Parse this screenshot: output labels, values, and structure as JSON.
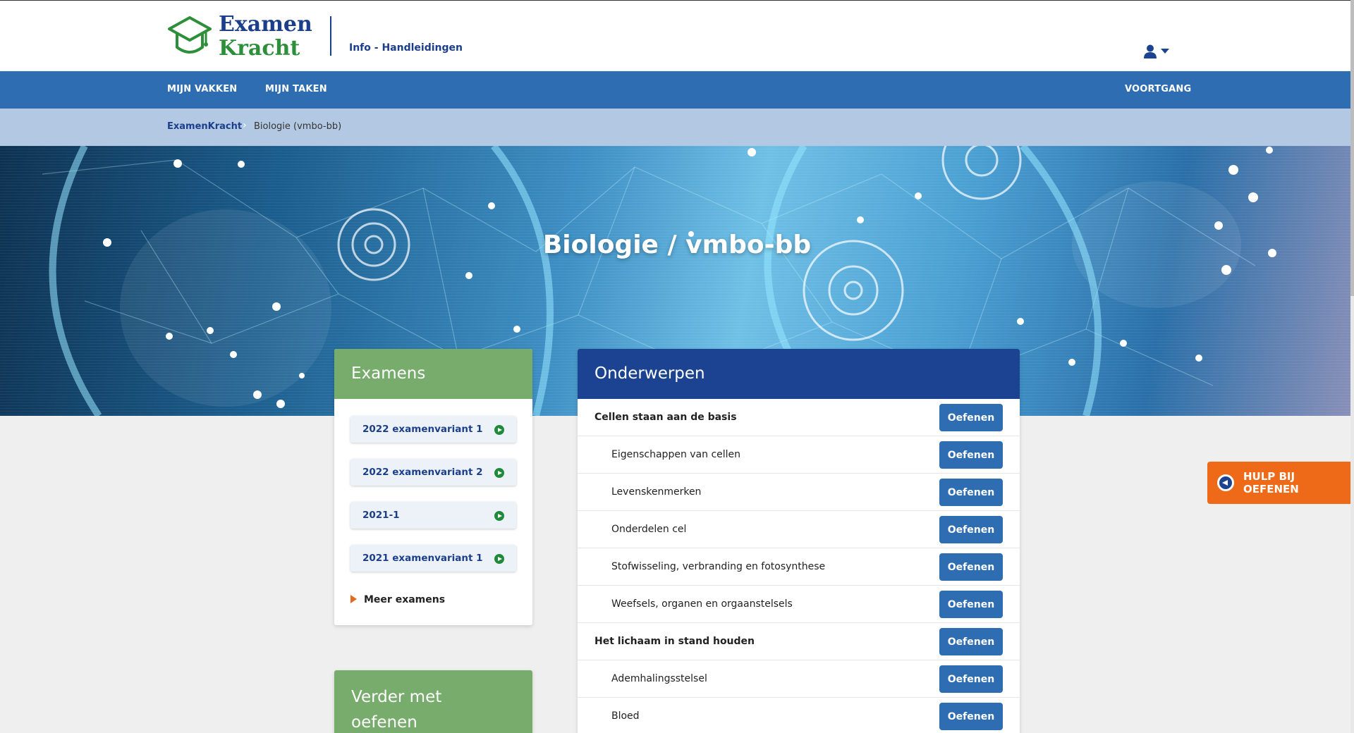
{
  "header": {
    "logo_line1": "Examen",
    "logo_line2": "Kracht",
    "info_link": "Info - Handleidingen"
  },
  "nav": {
    "mijn_vakken": "MIJN VAKKEN",
    "mijn_taken": "MIJN TAKEN",
    "voortgang": "VOORTGANG"
  },
  "breadcrumb": {
    "home": "ExamenKracht",
    "current": "Biologie (vmbo-bb)"
  },
  "hero": {
    "title": "Biologie / vmbo-bb"
  },
  "examens": {
    "title": "Examens",
    "items": [
      {
        "label": "2022 examenvariant 1"
      },
      {
        "label": "2022 examenvariant 2"
      },
      {
        "label": "2021-1"
      },
      {
        "label": "2021 examenvariant 1"
      }
    ],
    "more": "Meer examens"
  },
  "verder": {
    "title_line1": "Verder met",
    "title_line2": "oefenen"
  },
  "onderwerpen": {
    "title": "Onderwerpen",
    "button_label": "Oefenen",
    "rows": [
      {
        "label": "Cellen staan aan de basis",
        "level": "main"
      },
      {
        "label": "Eigenschappen van cellen",
        "level": "sub"
      },
      {
        "label": "Levenskenmerken",
        "level": "sub"
      },
      {
        "label": "Onderdelen cel",
        "level": "sub"
      },
      {
        "label": "Stofwisseling, verbranding en fotosynthese",
        "level": "sub"
      },
      {
        "label": "Weefsels, organen en orgaanstelsels",
        "level": "sub"
      },
      {
        "label": "Het lichaam in stand houden",
        "level": "main"
      },
      {
        "label": "Ademhalingsstelsel",
        "level": "sub"
      },
      {
        "label": "Bloed",
        "level": "sub"
      }
    ]
  },
  "help_tab": {
    "label": "HULP BIJ OEFENEN"
  },
  "colors": {
    "primary_blue": "#2f6db3",
    "dark_blue": "#1b4392",
    "green": "#78ac6c",
    "orange": "#ef6a18"
  },
  "icons": [
    "graduation-cap-logo-icon",
    "user-icon",
    "caret-down-icon",
    "play-circle-icon",
    "triangle-right-icon",
    "arrow-left-circle-icon"
  ]
}
